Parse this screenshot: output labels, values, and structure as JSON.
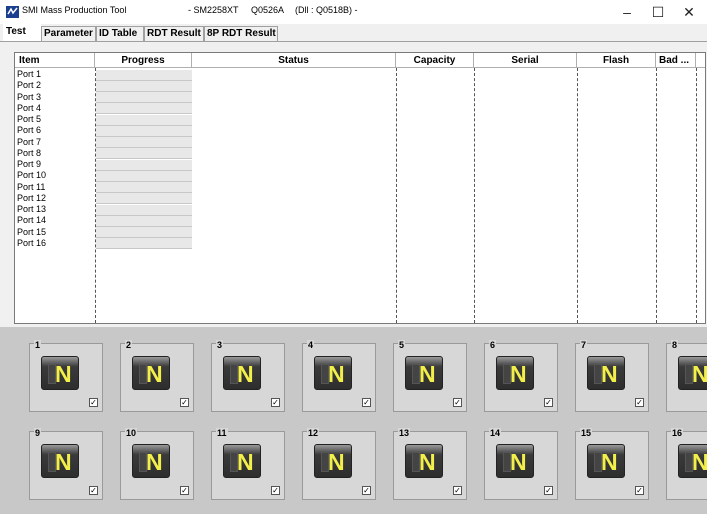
{
  "window": {
    "app_name": "SMI Mass Production Tool",
    "controller": "- SM2258XT",
    "version": "Q0526A",
    "dll": "(Dll : Q0518B) -",
    "minimize": "–",
    "maximize": "☐",
    "close": "✕"
  },
  "tabs": [
    "Test",
    "Parameter",
    "ID Table",
    "RDT Result",
    "8P RDT Result"
  ],
  "table": {
    "columns": [
      "Item",
      "Progress",
      "Status",
      "Capacity",
      "Serial",
      "Flash",
      "Bad ..."
    ],
    "rows": [
      "Port 1",
      "Port 2",
      "Port 3",
      "Port 4",
      "Port 5",
      "Port 6",
      "Port 7",
      "Port 8",
      "Port 9",
      "Port 10",
      "Port 11",
      "Port 12",
      "Port 13",
      "Port 14",
      "Port 15",
      "Port 16"
    ]
  },
  "ports": [
    {
      "num": "1",
      "glyph": "N",
      "checked": "✓"
    },
    {
      "num": "2",
      "glyph": "N",
      "checked": "✓"
    },
    {
      "num": "3",
      "glyph": "N",
      "checked": "✓"
    },
    {
      "num": "4",
      "glyph": "N",
      "checked": "✓"
    },
    {
      "num": "5",
      "glyph": "N",
      "checked": "✓"
    },
    {
      "num": "6",
      "glyph": "N",
      "checked": "✓"
    },
    {
      "num": "7",
      "glyph": "N",
      "checked": "✓"
    },
    {
      "num": "8",
      "glyph": "N",
      "checked": "✓"
    },
    {
      "num": "9",
      "glyph": "N",
      "checked": "✓"
    },
    {
      "num": "10",
      "glyph": "N",
      "checked": "✓"
    },
    {
      "num": "11",
      "glyph": "N",
      "checked": "✓"
    },
    {
      "num": "12",
      "glyph": "N",
      "checked": "✓"
    },
    {
      "num": "13",
      "glyph": "N",
      "checked": "✓"
    },
    {
      "num": "14",
      "glyph": "N",
      "checked": "✓"
    },
    {
      "num": "15",
      "glyph": "N",
      "checked": "✓"
    },
    {
      "num": "16",
      "glyph": "N",
      "checked": "✓"
    }
  ]
}
